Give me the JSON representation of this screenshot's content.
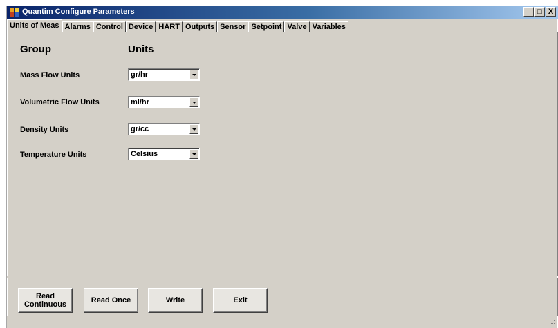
{
  "window": {
    "title": "Quantim Configure Parameters"
  },
  "controls": {
    "minimize": "_",
    "maximize": "□",
    "close": "X"
  },
  "tabs": [
    {
      "label": "Units of Meas",
      "active": true
    },
    {
      "label": "Alarms",
      "active": false
    },
    {
      "label": "Control",
      "active": false
    },
    {
      "label": "Device",
      "active": false
    },
    {
      "label": "HART",
      "active": false
    },
    {
      "label": "Outputs",
      "active": false
    },
    {
      "label": "Sensor",
      "active": false
    },
    {
      "label": "Setpoint",
      "active": false
    },
    {
      "label": "Valve",
      "active": false
    },
    {
      "label": "Variables",
      "active": false
    }
  ],
  "panel": {
    "group_header": "Group",
    "units_header": "Units",
    "rows": [
      {
        "label": "Mass Flow Units",
        "value": "gr/hr"
      },
      {
        "label": "Volumetric Flow Units",
        "value": "ml/hr"
      },
      {
        "label": "Density Units",
        "value": "gr/cc"
      },
      {
        "label": "Temperature Units",
        "value": "Celsius"
      }
    ]
  },
  "buttons": {
    "read_continuous_line1": "Read",
    "read_continuous_line2": "Continuous",
    "read_once": "Read Once",
    "write": "Write",
    "exit": "Exit"
  },
  "colors": {
    "title_start": "#0a246a",
    "title_end": "#a6caf0",
    "face": "#d4d0c8"
  }
}
